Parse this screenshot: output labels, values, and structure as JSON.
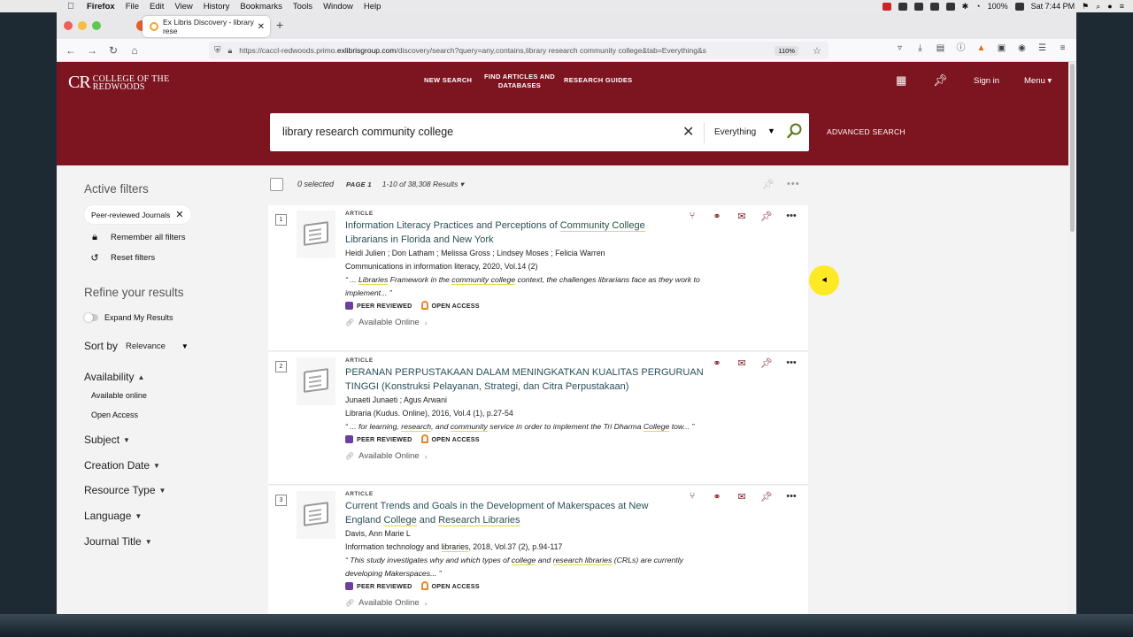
{
  "menubar": {
    "app": "Firefox",
    "items": [
      "File",
      "Edit",
      "View",
      "History",
      "Bookmarks",
      "Tools",
      "Window",
      "Help"
    ],
    "battery": "100%",
    "clock": "Sat 7:44 PM"
  },
  "browser": {
    "tab_title": "Ex Libris Discovery - library rese",
    "url_prefix": "https://caccl-redwoods.primo.",
    "url_domain": "exlibrisgroup.com",
    "url_suffix": "/discovery/search?query=any,contains,library research community college&tab=Everything&s",
    "zoom": "110%"
  },
  "header": {
    "logo_mark": "CR",
    "logo_text_1": "COLLEGE OF THE",
    "logo_text_2": "REDWOODS",
    "nav": [
      "NEW SEARCH",
      "FIND ARTICLES AND",
      "DATABASES",
      "RESEARCH GUIDES"
    ],
    "sign_in": "Sign in",
    "menu": "Menu"
  },
  "search": {
    "query": "library research community college",
    "scope": "Everything",
    "advanced": "ADVANCED SEARCH"
  },
  "sidebar": {
    "active_filters_title": "Active filters",
    "active_filter_chip": "Peer-reviewed Journals",
    "remember": "Remember all filters",
    "reset": "Reset filters",
    "refine_title": "Refine your results",
    "expand": "Expand My Results",
    "sort_label": "Sort by",
    "sort_value": "Relevance",
    "availability": "Availability",
    "availability_options": [
      "Available online",
      "Open Access"
    ],
    "facets": [
      "Subject",
      "Creation Date",
      "Resource Type",
      "Language",
      "Journal Title"
    ]
  },
  "list": {
    "selected": "0 selected",
    "page": "PAGE 1",
    "count": "1-10 of 38,308 Results"
  },
  "results": [
    {
      "num": "1",
      "type": "ARTICLE",
      "title_1": "Information Literacy Practices and Perceptions of ",
      "title_hl_1": "Community College",
      "title_2": "Librarians in Florida and New York",
      "authors": "Heidi Julien ; Don Latham ; Melissa Gross ; Lindsey Moses ; Felicia Warren",
      "source": "Communications in information literacy, 2020, Vol.14 (2)",
      "snippet_a": "“ ... ",
      "snippet_hl_a": "Libraries",
      "snippet_b": " Framework in the ",
      "snippet_hl_b": "community college",
      "snippet_c": " context, the challenges librarians face as they work to",
      "snippet_d": "implement... ”",
      "peer": "PEER REVIEWED",
      "open": "OPEN ACCESS",
      "avail": "Available Online"
    },
    {
      "num": "2",
      "type": "ARTICLE",
      "title_1": "PERANAN PERPUSTAKAAN DALAM MENINGKATKAN KUALITAS PERGURUAN",
      "title_2": "TINGGI (Konstruksi Pelayanan, Strategi, dan Citra Perpustakaan)",
      "authors": "Junaeti Junaeti ; Agus Arwani",
      "source": "Libraria (Kudus. Online), 2016, Vol.4 (1), p.27-54",
      "snippet_a": "“ ... for learning, ",
      "snippet_hl_a": "research",
      "snippet_b": ", and ",
      "snippet_hl_b": "community",
      "snippet_c": " service in order to implement the Tri Dharma ",
      "snippet_hl_c": "College",
      "snippet_d": " tow... ”",
      "peer": "PEER REVIEWED",
      "open": "OPEN ACCESS",
      "avail": "Available Online"
    },
    {
      "num": "3",
      "type": "ARTICLE",
      "title_1": "Current Trends and Goals in the Development of Makerspaces at New",
      "title_2a": "England ",
      "title_hl_2": "College",
      "title_2b": " and ",
      "title_hl_3": "Research Libraries",
      "authors": "Davis, Ann Marie L",
      "source_a": "Information technology and ",
      "source_hl": "libraries",
      "source_b": ", 2018, Vol.37 (2), p.94-117",
      "snippet_a": "“ This study investigates why and which types of ",
      "snippet_hl_a": "college",
      "snippet_b": " and ",
      "snippet_hl_b": "research libraries",
      "snippet_c": " (CRLs) are currently",
      "snippet_d": "developing Makerspaces... ”",
      "peer": "PEER REVIEWED",
      "open": "OPEN ACCESS",
      "avail": "Available Online"
    }
  ]
}
